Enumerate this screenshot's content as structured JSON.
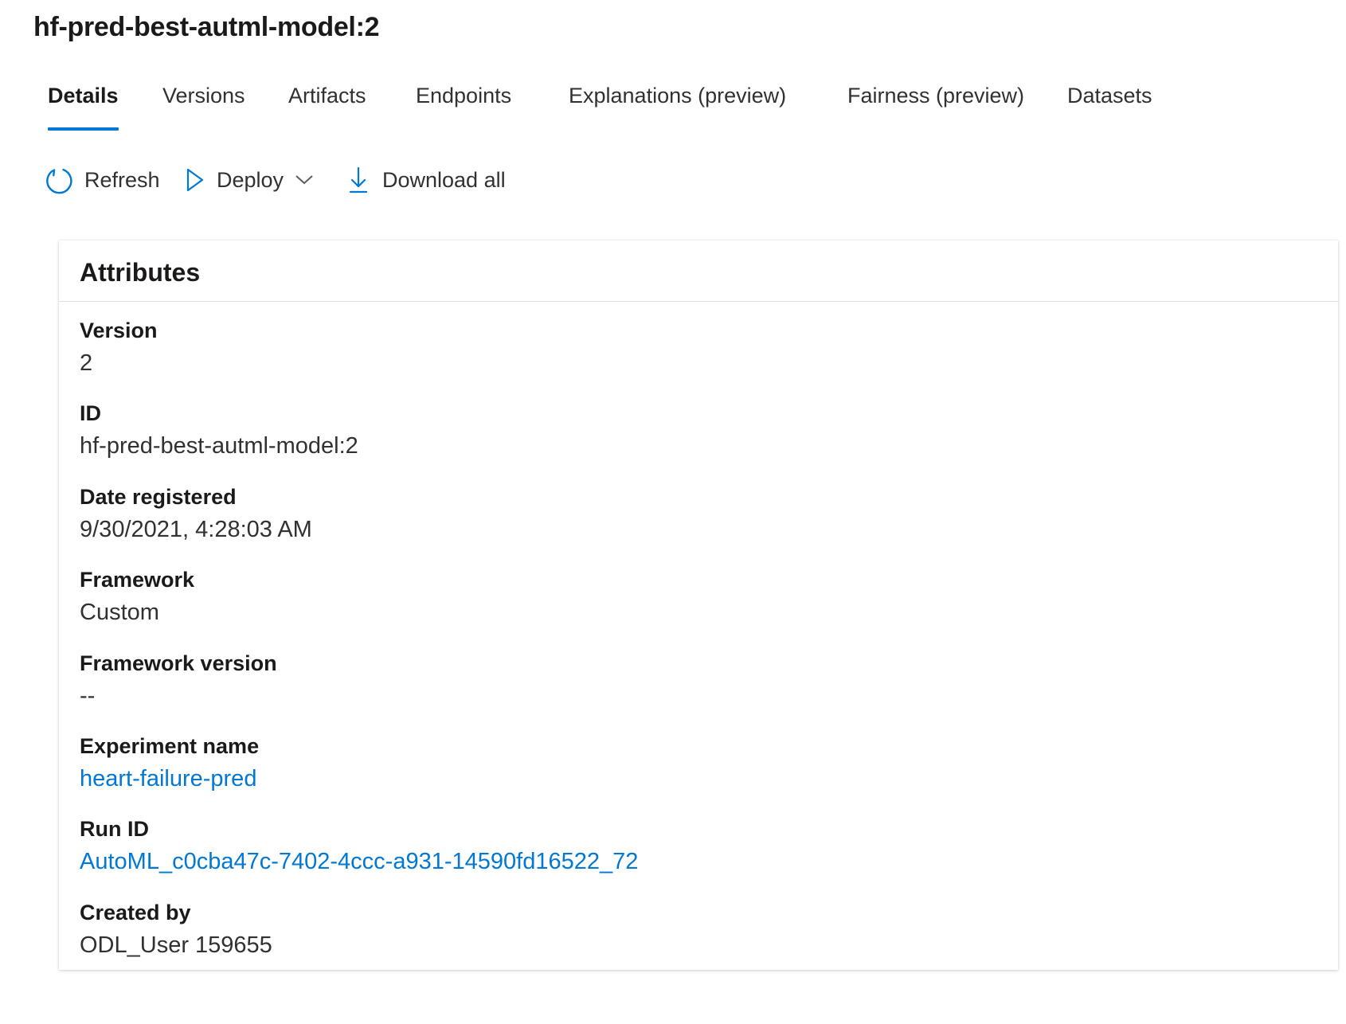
{
  "page": {
    "title": "hf-pred-best-autml-model:2"
  },
  "tabs": [
    {
      "label": "Details",
      "active": true
    },
    {
      "label": "Versions"
    },
    {
      "label": "Artifacts"
    },
    {
      "label": "Endpoints"
    },
    {
      "label": "Explanations (preview)"
    },
    {
      "label": "Fairness (preview)"
    },
    {
      "label": "Datasets"
    }
  ],
  "toolbar": {
    "refresh_label": "Refresh",
    "deploy_label": "Deploy",
    "download_label": "Download all",
    "icons": [
      "refresh-icon",
      "play-icon",
      "chevron-down-icon",
      "download-icon"
    ]
  },
  "attributes": {
    "title": "Attributes",
    "items": [
      {
        "label": "Version",
        "value": "2"
      },
      {
        "label": "ID",
        "value": "hf-pred-best-autml-model:2"
      },
      {
        "label": "Date registered",
        "value": "9/30/2021, 4:28:03 AM"
      },
      {
        "label": "Framework",
        "value": "Custom"
      },
      {
        "label": "Framework version",
        "value": "--"
      },
      {
        "label": "Experiment name",
        "value": "heart-failure-pred",
        "link": true
      },
      {
        "label": "Run ID",
        "value": "AutoML_c0cba47c-7402-4ccc-a931-14590fd16522_72",
        "link": true
      },
      {
        "label": "Created by",
        "value": "ODL_User 159655"
      }
    ]
  },
  "colors": {
    "accent": "#0078d4",
    "text": "#1b1a19",
    "value_text": "#323130",
    "divider": "#e1dfdd"
  }
}
